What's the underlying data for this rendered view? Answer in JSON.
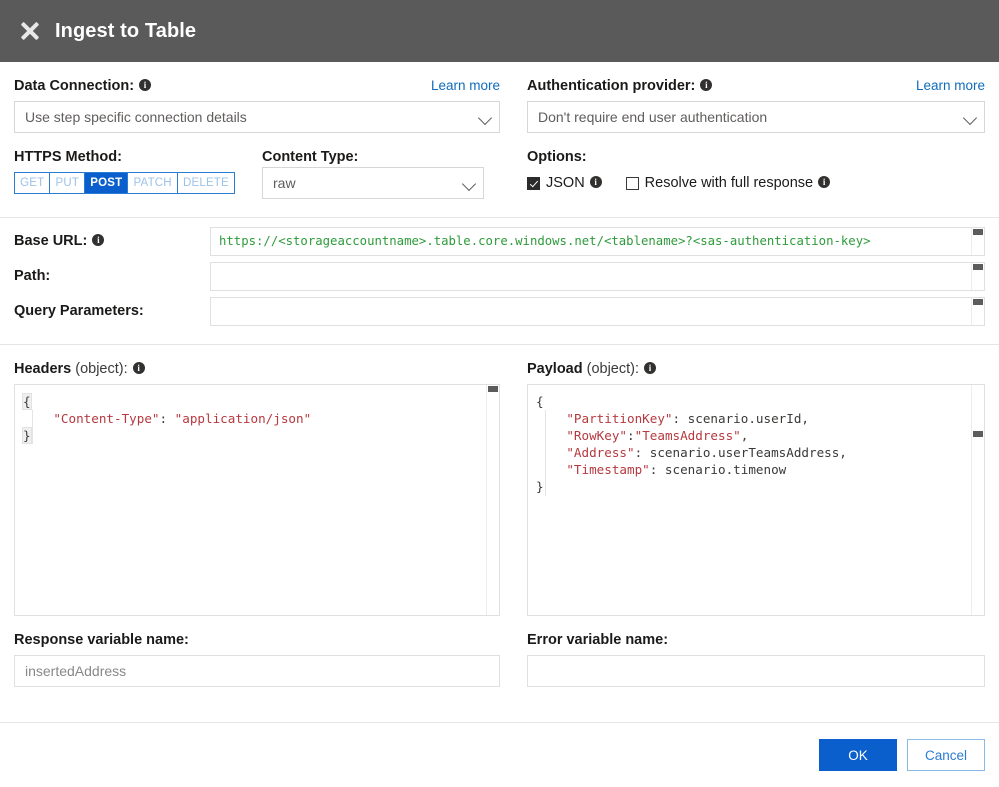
{
  "window": {
    "title": "Ingest to Table",
    "close_icon": "close-x-icon"
  },
  "data_connection": {
    "label": "Data Connection:",
    "learn_more": "Learn more",
    "value": "Use step specific connection details"
  },
  "authentication_provider": {
    "label": "Authentication provider:",
    "learn_more": "Learn more",
    "value": "Don't require end user authentication"
  },
  "https_method": {
    "label": "HTTPS Method:",
    "options": [
      "GET",
      "PUT",
      "POST",
      "PATCH",
      "DELETE"
    ],
    "selected": "POST"
  },
  "content_type": {
    "label": "Content Type:",
    "value": "raw"
  },
  "options": {
    "label": "Options:",
    "json": {
      "label": "JSON",
      "checked": true
    },
    "resolve_full_response": {
      "label": "Resolve with full response",
      "checked": false
    }
  },
  "request": {
    "base_url": {
      "label": "Base URL:",
      "value": "https://<storageaccountname>.table.core.windows.net/<tablename>?<sas-authentication-key>"
    },
    "path": {
      "label": "Path:",
      "value": ""
    },
    "query_parameters": {
      "label": "Query Parameters:",
      "value": ""
    }
  },
  "headers": {
    "label": "Headers",
    "type_hint": "(object):",
    "lines": [
      {
        "indent": 0,
        "parts": [
          {
            "t": "brace",
            "v": "{"
          }
        ]
      },
      {
        "indent": 1,
        "parts": [
          {
            "t": "str",
            "v": "\"Content-Type\""
          },
          {
            "t": "plain",
            "v": ": "
          },
          {
            "t": "str",
            "v": "\"application/json\""
          }
        ]
      },
      {
        "indent": 0,
        "parts": [
          {
            "t": "brace",
            "v": "}"
          }
        ]
      }
    ]
  },
  "payload": {
    "label": "Payload",
    "type_hint": "(object):",
    "lines": [
      {
        "indent": 0,
        "parts": [
          {
            "t": "plain",
            "v": "{"
          }
        ]
      },
      {
        "indent": 1,
        "parts": [
          {
            "t": "str",
            "v": "\"PartitionKey\""
          },
          {
            "t": "plain",
            "v": ": scenario.userId,"
          }
        ]
      },
      {
        "indent": 1,
        "parts": [
          {
            "t": "str",
            "v": "\"RowKey\""
          },
          {
            "t": "plain",
            "v": ":"
          },
          {
            "t": "str",
            "v": "\"TeamsAddress\""
          },
          {
            "t": "plain",
            "v": ","
          }
        ]
      },
      {
        "indent": 1,
        "parts": [
          {
            "t": "str",
            "v": "\"Address\""
          },
          {
            "t": "plain",
            "v": ": scenario.userTeamsAddress,"
          }
        ]
      },
      {
        "indent": 1,
        "parts": [
          {
            "t": "str",
            "v": "\"Timestamp\""
          },
          {
            "t": "plain",
            "v": ": scenario.timenow"
          }
        ]
      },
      {
        "indent": 0,
        "parts": [
          {
            "t": "plain",
            "v": "}"
          }
        ]
      }
    ]
  },
  "response_variable": {
    "label": "Response variable name:",
    "value": "insertedAddress"
  },
  "error_variable": {
    "label": "Error variable name:",
    "value": ""
  },
  "footer": {
    "ok": "OK",
    "cancel": "Cancel"
  },
  "colors": {
    "accent_blue": "#0b5fcc",
    "link_blue": "#0f6cbd",
    "titlebar": "#5a5a5a",
    "code_green": "#2e9b3a",
    "code_string": "#b5393f"
  }
}
